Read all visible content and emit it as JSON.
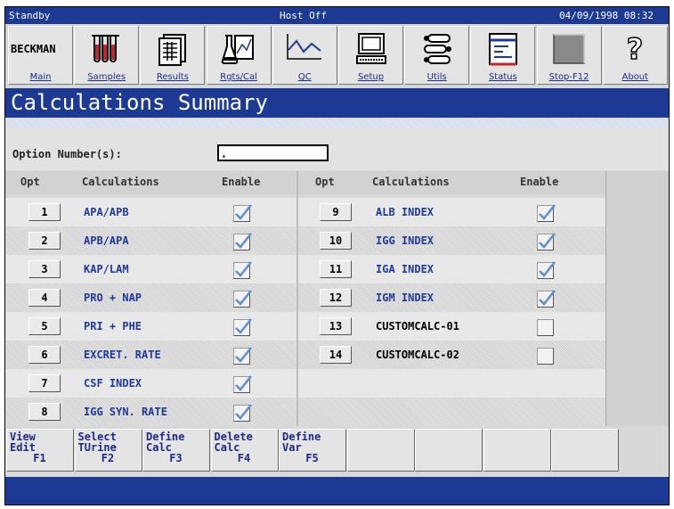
{
  "status_bar": {
    "mode": "Standby",
    "host": "Host Off",
    "datetime": "04/09/1998 08:32"
  },
  "toolbar": [
    {
      "label": "Main",
      "icon": "beckman-logo",
      "logo_text": "BECKMAN"
    },
    {
      "label": "Samples",
      "icon": "test-tubes-icon"
    },
    {
      "label": "Results",
      "icon": "documents-icon"
    },
    {
      "label": "Rgts/Cal",
      "icon": "flask-icon"
    },
    {
      "label": "QC",
      "icon": "qc-chart-icon"
    },
    {
      "label": "Setup",
      "icon": "computer-icon"
    },
    {
      "label": "Utils",
      "icon": "wrench-icon"
    },
    {
      "label": "Status",
      "icon": "status-panel-icon"
    },
    {
      "label": "Stop-F12",
      "icon": "stop-icon"
    },
    {
      "label": "About",
      "icon": "question-icon"
    }
  ],
  "title": "Calculations Summary",
  "option_number": {
    "label": "Option Number(s):",
    "value": ""
  },
  "columns": {
    "opt": "Opt",
    "calculations": "Calculations",
    "enable": "Enable"
  },
  "left_rows": [
    {
      "opt": "1",
      "calc": "APA/APB",
      "enabled": true
    },
    {
      "opt": "2",
      "calc": "APB/APA",
      "enabled": true
    },
    {
      "opt": "3",
      "calc": "KAP/LAM",
      "enabled": true
    },
    {
      "opt": "4",
      "calc": "PRO + NAP",
      "enabled": true
    },
    {
      "opt": "5",
      "calc": "PRI + PHE",
      "enabled": true
    },
    {
      "opt": "6",
      "calc": "EXCRET. RATE",
      "enabled": true
    },
    {
      "opt": "7",
      "calc": "CSF INDEX",
      "enabled": true
    },
    {
      "opt": "8",
      "calc": "IGG SYN. RATE",
      "enabled": true
    }
  ],
  "right_rows": [
    {
      "opt": "9",
      "calc": "ALB INDEX",
      "enabled": true
    },
    {
      "opt": "10",
      "calc": "IGG INDEX",
      "enabled": true
    },
    {
      "opt": "11",
      "calc": "IGA INDEX",
      "enabled": true
    },
    {
      "opt": "12",
      "calc": "IGM INDEX",
      "enabled": true
    },
    {
      "opt": "13",
      "calc": "CUSTOMCALC-01",
      "enabled": false
    },
    {
      "opt": "14",
      "calc": "CUSTOMCALC-02",
      "enabled": false
    }
  ],
  "function_keys": [
    {
      "lines": [
        "View",
        "Edit"
      ],
      "key": "F1"
    },
    {
      "lines": [
        "Select",
        "TUrine"
      ],
      "key": "F2"
    },
    {
      "lines": [
        "Define",
        "Calc"
      ],
      "key": "F3"
    },
    {
      "lines": [
        "Delete",
        "Calc"
      ],
      "key": "F4"
    },
    {
      "lines": [
        "Define",
        "Var"
      ],
      "key": "F5"
    },
    {
      "lines": [],
      "key": ""
    },
    {
      "lines": [],
      "key": ""
    },
    {
      "lines": [],
      "key": ""
    },
    {
      "lines": [],
      "key": ""
    }
  ],
  "colors": {
    "accent": "#1c3a93",
    "enabled_text": "#1e3a9a",
    "check": "#5a8fd6"
  }
}
